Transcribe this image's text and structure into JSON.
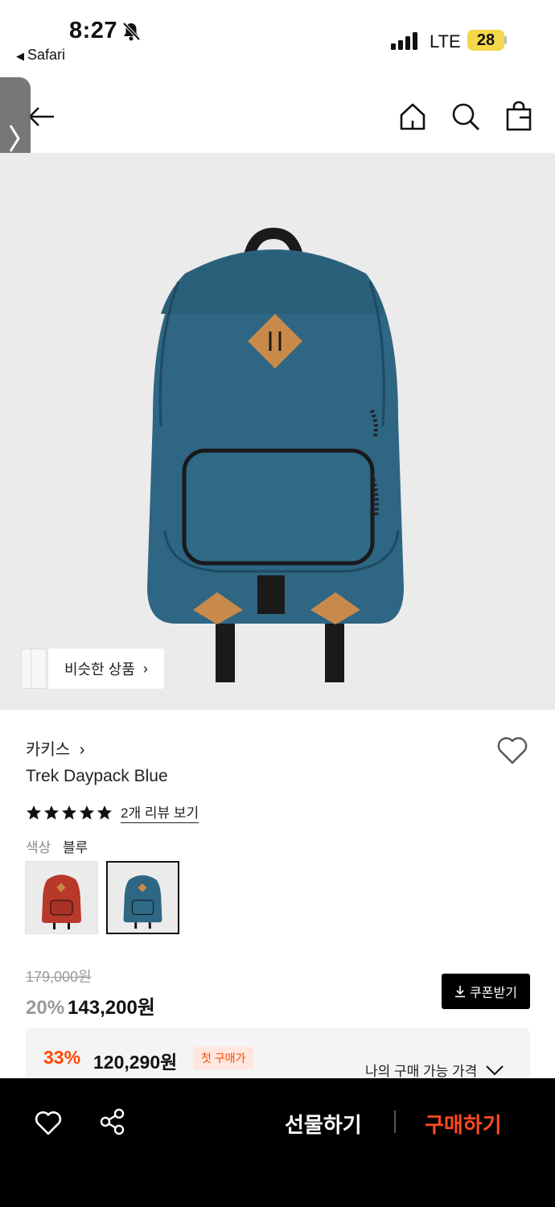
{
  "status_bar": {
    "time": "8:27",
    "back_app": "Safari",
    "network": "LTE",
    "battery": "28"
  },
  "icons": {
    "back": "arrow-left-icon",
    "home": "home-icon",
    "search": "search-icon",
    "cart": "shopping-bag-icon",
    "wishlist": "heart-icon",
    "share": "share-icon",
    "star": "star-icon",
    "download": "download-icon",
    "chevron": "chevron-down-icon"
  },
  "product": {
    "similar_label": "비슷한 상품",
    "brand": "카키스",
    "name": "Trek Daypack Blue",
    "rating": 5,
    "review_link": "2개 리뷰 보기",
    "color_label": "색상",
    "color_value": "블루",
    "swatches": [
      {
        "name": "red",
        "color": "#b8382a"
      },
      {
        "name": "blue",
        "color": "#2e6683",
        "selected": true
      }
    ]
  },
  "pricing": {
    "original": "179,000원",
    "discount": "20%",
    "price": "143,200원",
    "coupon_label": "쿠폰받기",
    "member_discount": "33%",
    "member_price": "120,290원",
    "member_badge": "첫 구매가",
    "my_price_label": "나의 구매 가능 가격"
  },
  "bottom_bar": {
    "gift_label": "선물하기",
    "buy_label": "구매하기"
  },
  "colors": {
    "accent": "#ff4800",
    "bag_blue": "#2e6683",
    "leather": "#c88a4a",
    "image_bg": "#ebebeb"
  }
}
